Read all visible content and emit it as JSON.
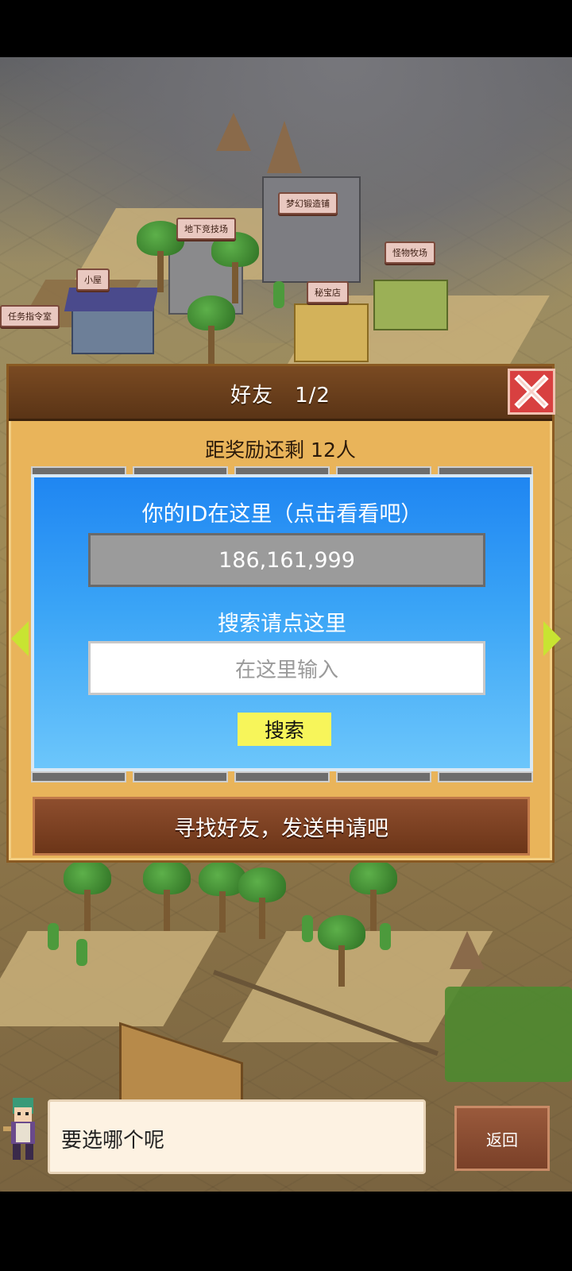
{
  "map_labels": {
    "dream_forge": "梦幻锻造铺",
    "underground_arena": "地下竞技场",
    "monster_ranch": "怪物牧场",
    "cottage": "小屋",
    "treasure_shop": "秘宝店",
    "quest_room": "任务指令室"
  },
  "dialog": {
    "title": "好友　1/2",
    "reward_text": "距奖励还剩 12人",
    "id_caption": "你的ID在这里（点击看看吧）",
    "player_id": "186,161,999",
    "search_caption": "搜索请点这里",
    "search_placeholder": "在这里输入",
    "search_button": "搜索",
    "find_friends_button": "寻找好友，发送申请吧"
  },
  "bottom": {
    "message": "要选哪个呢",
    "back_button": "返回"
  },
  "icons": {
    "close": "close-icon",
    "prev": "arrow-left-icon",
    "next": "arrow-right-icon",
    "character": "character-avatar-icon"
  },
  "colors": {
    "dialog_bg": "#e9b45a",
    "header_bg": "#5a3416",
    "panel_blue": "#1f86f2",
    "search_button": "#f7f55a",
    "close_red": "#d84040",
    "arrow_green": "#c8e432"
  }
}
